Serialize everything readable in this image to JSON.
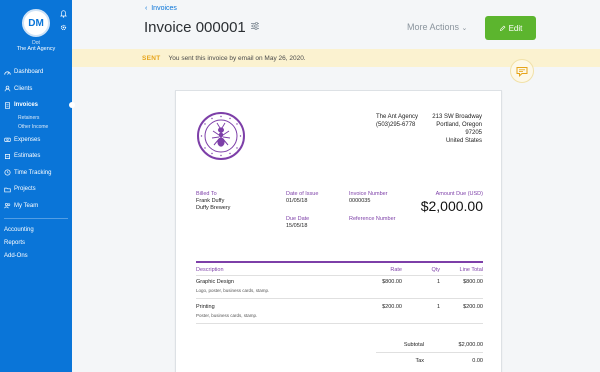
{
  "user": {
    "initials": "DM",
    "role": "Dot",
    "company": "The Ant Agency"
  },
  "nav": {
    "items": [
      {
        "label": "Dashboard",
        "icon": "dashboard-icon"
      },
      {
        "label": "Clients",
        "icon": "clients-icon"
      },
      {
        "label": "Invoices",
        "icon": "invoices-icon",
        "active": true
      },
      {
        "label": "Expenses",
        "icon": "expenses-icon"
      },
      {
        "label": "Estimates",
        "icon": "estimates-icon"
      },
      {
        "label": "Time Tracking",
        "icon": "clock-icon"
      },
      {
        "label": "Projects",
        "icon": "projects-icon"
      },
      {
        "label": "My Team",
        "icon": "team-icon"
      }
    ],
    "invoice_sub": [
      "Retainers",
      "Other Income"
    ],
    "bottom": [
      "Accounting",
      "Reports",
      "Add-Ons"
    ]
  },
  "header": {
    "breadcrumb": "Invoices",
    "title": "Invoice 000001",
    "more_actions": "More Actions",
    "edit_label": "Edit"
  },
  "banner": {
    "status": "SENT",
    "message": "You sent this invoice by email on May 26, 2020."
  },
  "invoice": {
    "from_name": "The Ant Agency",
    "from_phone": "(503)295-6778",
    "address": [
      "213 SW Broadway",
      "Portland, Oregon",
      "97205",
      "United States"
    ],
    "billed_to_label": "Billed To",
    "billed_to": [
      "Frank Duffy",
      "Duffy Brewery"
    ],
    "date_of_issue_label": "Date of Issue",
    "date_of_issue": "01/05/18",
    "due_date_label": "Due Date",
    "due_date": "15/05/18",
    "invoice_number_label": "Invoice Number",
    "invoice_number": "0000035",
    "reference_number_label": "Reference Number",
    "amount_due_label": "Amount Due (USD)",
    "amount_due": "$2,000.00",
    "columns": [
      "Description",
      "Rate",
      "Qty",
      "Line Total"
    ],
    "lines": [
      {
        "name": "Graphic Design",
        "desc": "Logo, poster, business cards, stamp.",
        "rate": "$800.00",
        "qty": "1",
        "total": "$800.00"
      },
      {
        "name": "Printing",
        "desc": "Poster, business cards, stamp.",
        "rate": "$200.00",
        "qty": "1",
        "total": "$200.00"
      }
    ],
    "subtotal_label": "Subtotal",
    "subtotal": "$2,000.00",
    "tax_label": "Tax",
    "tax": "0.00"
  },
  "colors": {
    "sidebar": "#0a75d8",
    "accent_purple": "#7d3fa8",
    "edit_green": "#5cb52e",
    "banner_bg": "#fbf2d0",
    "sent_orange": "#e6a41a"
  }
}
